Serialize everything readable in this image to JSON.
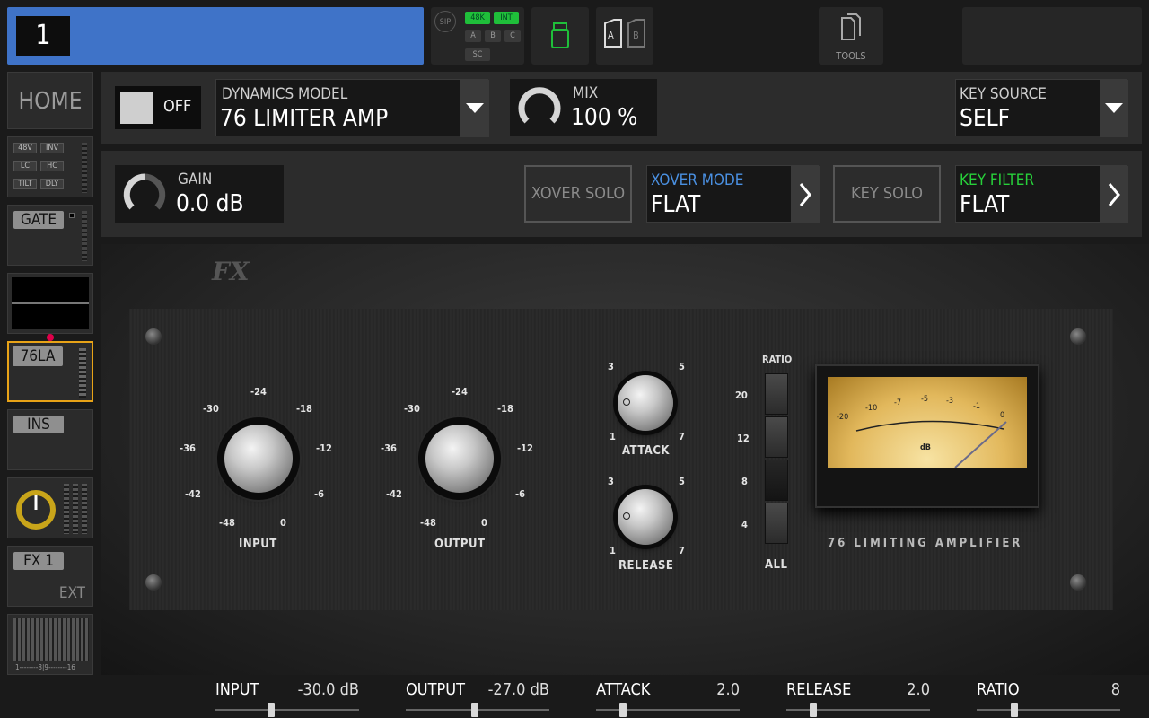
{
  "channel": {
    "number": "1"
  },
  "topbar": {
    "sip": "SIP",
    "rate": "48K",
    "clock": "INT",
    "buses": [
      "A",
      "B",
      "C"
    ],
    "sc": "SC",
    "scene": {
      "a": "A",
      "b": "B"
    },
    "tools": "TOOLS"
  },
  "sidebar": {
    "home": "HOME",
    "preamp": [
      "48V",
      "INV",
      "LC",
      "HC",
      "TILT",
      "DLY"
    ],
    "gate": "GATE",
    "comp": "76LA",
    "ins": "INS",
    "fx": "FX 1",
    "ext": "EXT",
    "meter_scale": "1--------8|9--------16"
  },
  "row1": {
    "power": "OFF",
    "model_label": "DYNAMICS MODEL",
    "model_value": "76 LIMITER AMP",
    "mix_label": "MIX",
    "mix_value": "100 %",
    "key_label": "KEY SOURCE",
    "key_value": "SELF"
  },
  "row2": {
    "gain_label": "GAIN",
    "gain_value": "0.0 dB",
    "xover_solo": "XOVER SOLO",
    "xover_mode_label": "XOVER MODE",
    "xover_mode_value": "FLAT",
    "key_solo": "KEY SOLO",
    "key_filter_label": "KEY FILTER",
    "key_filter_value": "FLAT"
  },
  "plugin": {
    "logo": "FX",
    "input_label": "INPUT",
    "output_label": "OUTPUT",
    "attack_label": "ATTACK",
    "release_label": "RELEASE",
    "ratio_label": "RATIO",
    "ratio_all": "ALL",
    "ratio_values": [
      "20",
      "12",
      "8",
      "4"
    ],
    "io_ticks": [
      "-24",
      "-30",
      "-18",
      "-36",
      "-12",
      "-42",
      "-6",
      "-48",
      "0"
    ],
    "ar_ticks": [
      "3",
      "5",
      "1",
      "7"
    ],
    "meter_ticks": [
      "-20",
      "-10",
      "-7",
      "-5",
      "-3",
      "-1",
      "0"
    ],
    "meter_unit": "dB",
    "brand": "76 LIMITING AMPLIFIER"
  },
  "params": [
    {
      "label": "INPUT",
      "value": "-30.0 dB",
      "pos": 0.38
    },
    {
      "label": "OUTPUT",
      "value": "-27.0 dB",
      "pos": 0.48
    },
    {
      "label": "ATTACK",
      "value": "2.0",
      "pos": 0.17
    },
    {
      "label": "RELEASE",
      "value": "2.0",
      "pos": 0.17
    },
    {
      "label": "RATIO",
      "value": "8",
      "pos": 0.25
    }
  ],
  "colors": {
    "accent_blue": "#3f73c8",
    "green": "#1fbf3a",
    "selected": "#e8a317",
    "xover_blue": "#4a90e2",
    "key_green": "#27d03a"
  }
}
